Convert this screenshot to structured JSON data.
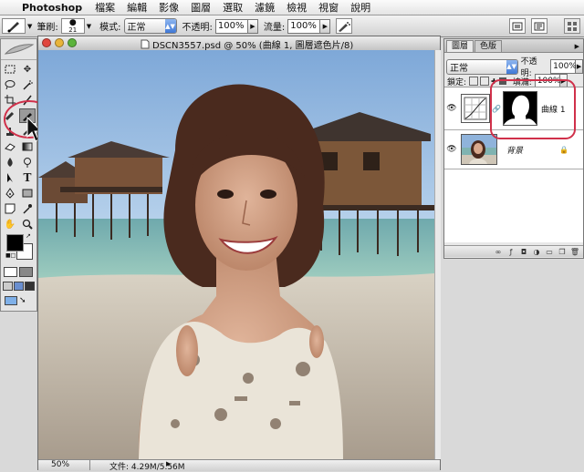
{
  "menubar": {
    "app_name": "Photoshop",
    "items": [
      "檔案",
      "編輯",
      "影像",
      "圖層",
      "選取",
      "濾鏡",
      "檢視",
      "視窗",
      "說明"
    ]
  },
  "options_bar": {
    "brush_label": "筆刷:",
    "brush_size": "21",
    "mode_label": "模式:",
    "mode_value": "正常",
    "opacity_label": "不透明:",
    "opacity_value": "100%",
    "flow_label": "流量:",
    "flow_value": "100%"
  },
  "document": {
    "title": "DSCN3557.psd @ 50% (曲線 1, 圖層遮色片/8)",
    "zoom": "50%",
    "file_info": "文件: 4.29M/5.56M"
  },
  "layers_panel": {
    "tabs": [
      "圖層",
      "色版"
    ],
    "blend_mode": "正常",
    "opacity_label": "不透明:",
    "opacity_value": "100%",
    "lock_label": "鎖定:",
    "fill_label": "填滿:",
    "fill_value": "100%",
    "layers": [
      {
        "name": "曲線 1"
      },
      {
        "name": "背景"
      }
    ]
  },
  "colors": {
    "highlight_circle": "#d0304a",
    "selected_tab": "#eaeaea"
  }
}
